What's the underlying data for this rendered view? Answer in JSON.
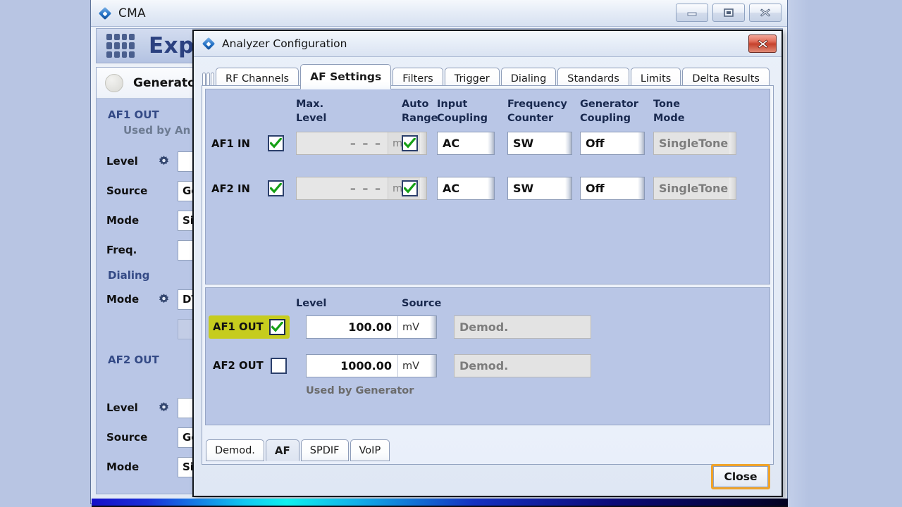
{
  "app_window": {
    "title": "CMA",
    "logo_icon": "rohde-schwarz-logo-icon",
    "buttons": [
      {
        "name": "minimize",
        "icon": "minimize-icon"
      },
      {
        "name": "maximize",
        "icon": "maximize-icon"
      },
      {
        "name": "close",
        "icon": "close-icon"
      }
    ]
  },
  "expert_header": {
    "grid_icon": "app-grid-icon",
    "title": "Exp"
  },
  "left_panel": {
    "generator": {
      "led_icon": "status-led-icon",
      "label": "Generator"
    },
    "af1_out": {
      "section": "AF1 OUT",
      "sub": "Used by An",
      "rows": [
        {
          "label": "Level",
          "gear": true,
          "value": ""
        },
        {
          "label": "Source",
          "gear": false,
          "value": "Ge"
        },
        {
          "label": "Mode",
          "gear": false,
          "value": "Sin"
        },
        {
          "label": "Freq.",
          "gear": false,
          "value": ""
        }
      ]
    },
    "dialing": {
      "section": "Dialing",
      "rows": [
        {
          "label": "Mode",
          "gear": true,
          "value": "DT"
        },
        {
          "label": "",
          "gear": false,
          "value": ""
        }
      ]
    },
    "af2_out": {
      "section": "AF2 OUT",
      "rows": [
        {
          "label": "Level",
          "gear": true,
          "value": ""
        },
        {
          "label": "Source",
          "gear": false,
          "value": "Ge"
        },
        {
          "label": "Mode",
          "gear": false,
          "value": "Sin"
        }
      ]
    }
  },
  "dialog": {
    "title": "Analyzer Configuration",
    "logo_icon": "rohde-schwarz-logo-icon",
    "close_icon": "close-x-icon",
    "tabs": [
      {
        "label": "RF Channels",
        "active": false
      },
      {
        "label": "AF Settings",
        "active": true
      },
      {
        "label": "Filters",
        "active": false
      },
      {
        "label": "Trigger",
        "active": false
      },
      {
        "label": "Dialing",
        "active": false
      },
      {
        "label": "Standards",
        "active": false
      },
      {
        "label": "Limits",
        "active": false
      },
      {
        "label": "Delta Results",
        "active": false
      }
    ],
    "input_section": {
      "headers": {
        "max_level": "Max.\nLevel",
        "auto_range": "Auto\nRange",
        "input_coupling": "Input\nCoupling",
        "frequency_counter": "Frequency\nCounter",
        "generator_coupling": "Generator\nCoupling",
        "tone_mode": "Tone\nMode"
      },
      "rows": [
        {
          "name": "AF1 IN",
          "enabled": true,
          "max_level": "– – –",
          "max_level_unit": "mV",
          "max_level_disabled": true,
          "auto_range": true,
          "input_coupling": "AC",
          "frequency_counter": "SW",
          "generator_coupling": "Off",
          "tone_mode": "SingleTone",
          "tone_mode_disabled": true
        },
        {
          "name": "AF2 IN",
          "enabled": true,
          "max_level": "– – –",
          "max_level_unit": "mV",
          "max_level_disabled": true,
          "auto_range": true,
          "input_coupling": "AC",
          "frequency_counter": "SW",
          "generator_coupling": "Off",
          "tone_mode": "SingleTone",
          "tone_mode_disabled": true
        }
      ]
    },
    "output_section": {
      "headers": {
        "level": "Level",
        "source": "Source"
      },
      "rows": [
        {
          "name": "AF1 OUT",
          "highlighted": true,
          "enabled": true,
          "level": "100.00",
          "level_unit": "mV",
          "source": "Demod.",
          "source_disabled": true,
          "note": ""
        },
        {
          "name": "AF2 OUT",
          "highlighted": false,
          "enabled": false,
          "level": "1000.00",
          "level_unit": "mV",
          "source": "Demod.",
          "source_disabled": true,
          "note": "Used by Generator"
        }
      ]
    },
    "source_tabs": [
      {
        "label": "Demod.",
        "active": false
      },
      {
        "label": "AF",
        "active": true
      },
      {
        "label": "SPDIF",
        "active": false
      },
      {
        "label": "VoIP",
        "active": false
      }
    ],
    "close_button": "Close"
  },
  "colors": {
    "highlight": "#c6cc1e",
    "accent_orange": "#f0a32a",
    "checkmark_green": "#15a015",
    "panel_blue": "#b9c6e6",
    "title_blue": "#2b4180"
  }
}
